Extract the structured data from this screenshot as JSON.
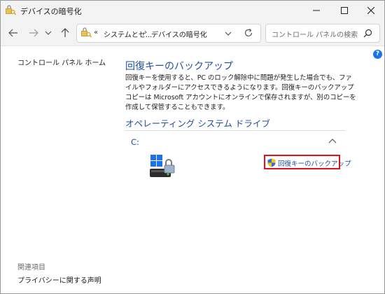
{
  "window": {
    "title": "デバイスの暗号化"
  },
  "address": {
    "overflow": "«",
    "crumbs": [
      "システムとセ...",
      "デバイスの暗号化"
    ],
    "separator": "›"
  },
  "search": {
    "placeholder": "コントロール パネルの検索"
  },
  "help": {
    "label": "?"
  },
  "sidebar": {
    "home_label": "コントロール パネル ホーム",
    "related_title": "関連項目",
    "related_items": [
      "プライバシーに関する声明"
    ]
  },
  "main": {
    "title": "回復キーのバックアップ",
    "description": "回復キーを使用すると、PC のロック解除中に問題が発生した場合でも、ファイルやフォルダーにアクセスできるようになります。回復キーのバックアップ コピーは Microsoft アカウントにオンラインで保存されますが、別のコピーを作成して保管することもできます。",
    "section_title": "オペレーティング システム ドライブ",
    "drive": {
      "label": "C:",
      "action_label": "回復キーのバックアップ"
    }
  },
  "colors": {
    "link": "#1f4e9d",
    "highlight_border": "#e0121b",
    "windows_blue": "#1a73e8"
  },
  "icons": {
    "app": "bitlocker-key-icon",
    "drive": "windows-drive-lock-icon",
    "action": "uac-shield-icon"
  }
}
